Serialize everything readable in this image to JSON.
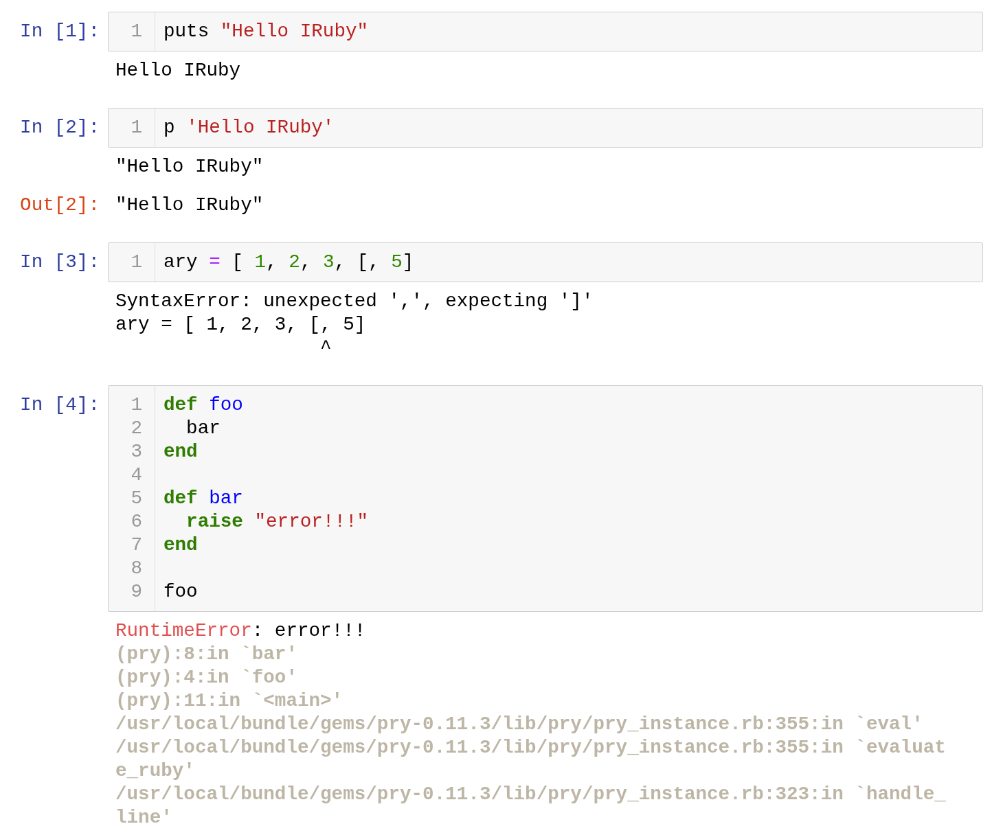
{
  "cells": [
    {
      "prompt": "In [1]:",
      "lines": [
        {
          "number": "1",
          "tokens": [
            {
              "text": "puts ",
              "kind": "plain"
            },
            {
              "text": "\"Hello IRuby\"",
              "kind": "string"
            }
          ]
        }
      ],
      "outputs": [
        {
          "kind": "stream",
          "lines": [
            "Hello IRuby"
          ]
        }
      ]
    },
    {
      "prompt": "In [2]:",
      "lines": [
        {
          "number": "1",
          "tokens": [
            {
              "text": "p ",
              "kind": "plain"
            },
            {
              "text": "'Hello IRuby'",
              "kind": "string"
            }
          ]
        }
      ],
      "outputs": [
        {
          "kind": "stream",
          "lines": [
            "\"Hello IRuby\""
          ]
        },
        {
          "kind": "result",
          "prompt": "Out[2]:",
          "lines": [
            "\"Hello IRuby\""
          ]
        }
      ]
    },
    {
      "prompt": "In [3]:",
      "lines": [
        {
          "number": "1",
          "tokens": [
            {
              "text": "ary ",
              "kind": "plain"
            },
            {
              "text": "=",
              "kind": "operator"
            },
            {
              "text": " [ ",
              "kind": "plain"
            },
            {
              "text": "1",
              "kind": "number"
            },
            {
              "text": ", ",
              "kind": "plain"
            },
            {
              "text": "2",
              "kind": "number"
            },
            {
              "text": ", ",
              "kind": "plain"
            },
            {
              "text": "3",
              "kind": "number"
            },
            {
              "text": ", [, ",
              "kind": "plain"
            },
            {
              "text": "5",
              "kind": "number"
            },
            {
              "text": "]",
              "kind": "plain"
            }
          ]
        }
      ],
      "outputs": [
        {
          "kind": "stream",
          "lines": [
            "SyntaxError: unexpected ',', expecting ']'",
            "ary = [ 1, 2, 3, [, 5]",
            "                  ^"
          ]
        }
      ]
    },
    {
      "prompt": "In [4]:",
      "lines": [
        {
          "number": "1",
          "tokens": [
            {
              "text": "def ",
              "kind": "keyword"
            },
            {
              "text": "foo",
              "kind": "name"
            }
          ]
        },
        {
          "number": "2",
          "tokens": [
            {
              "text": "  bar",
              "kind": "plain"
            }
          ]
        },
        {
          "number": "3",
          "tokens": [
            {
              "text": "end",
              "kind": "keyword"
            }
          ]
        },
        {
          "number": "4"
        },
        {
          "number": "5",
          "tokens": [
            {
              "text": "def ",
              "kind": "keyword"
            },
            {
              "text": "bar",
              "kind": "name"
            }
          ]
        },
        {
          "number": "6",
          "tokens": [
            {
              "text": "  raise ",
              "kind": "keyword"
            },
            {
              "text": "\"error!!!\"",
              "kind": "string"
            }
          ]
        },
        {
          "number": "7",
          "tokens": [
            {
              "text": "end",
              "kind": "keyword"
            }
          ]
        },
        {
          "number": "8"
        },
        {
          "number": "9",
          "tokens": [
            {
              "text": "foo",
              "kind": "plain"
            }
          ]
        }
      ],
      "outputs": [
        {
          "kind": "error",
          "name": "RuntimeError",
          "message": ": error!!!",
          "lines": [
            "(pry):8:in `bar'",
            "(pry):4:in `foo'",
            "(pry):11:in `<main>'",
            "/usr/local/bundle/gems/pry-0.11.3/lib/pry/pry_instance.rb:355:in `eval'",
            "/usr/local/bundle/gems/pry-0.11.3/lib/pry/pry_instance.rb:355:in `evaluat",
            "e_ruby'",
            "/usr/local/bundle/gems/pry-0.11.3/lib/pry/pry_instance.rb:323:in `handle_",
            "line'"
          ]
        }
      ]
    }
  ]
}
